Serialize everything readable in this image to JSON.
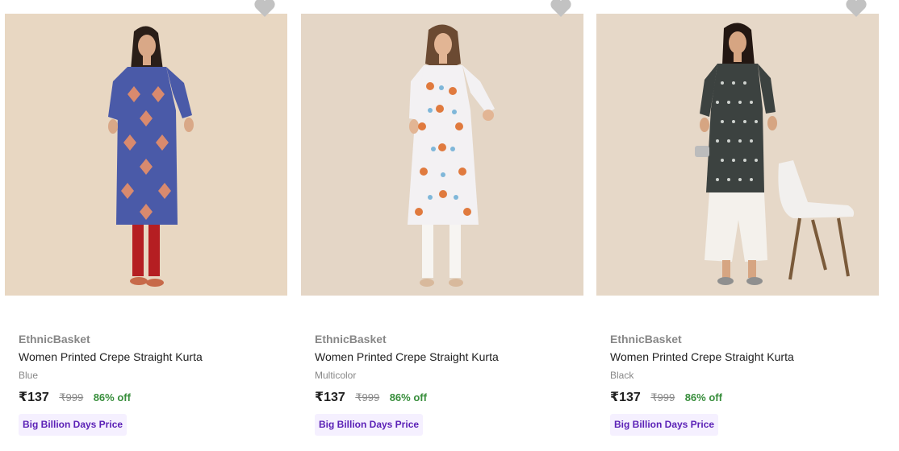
{
  "products": [
    {
      "brand": "EthnicBasket",
      "title": "Women Printed Crepe Straight Kurta",
      "color": "Blue",
      "price": "₹137",
      "mrp": "₹999",
      "discount": "86% off",
      "badge": "Big Billion Days Price",
      "wishlist_icon": "heart-icon",
      "image_colors": {
        "background": "#e8d7c2",
        "kurta": "#4a5aa8",
        "pattern": "#d98a6e",
        "bottom": "#b51e22"
      }
    },
    {
      "brand": "EthnicBasket",
      "title": "Women Printed Crepe Straight Kurta",
      "color": "Multicolor",
      "price": "₹137",
      "mrp": "₹999",
      "discount": "86% off",
      "badge": "Big Billion Days Price",
      "wishlist_icon": "heart-icon",
      "image_colors": {
        "background": "#e4d6c6",
        "kurta": "#f3f1f3",
        "pattern": "#e07a3e",
        "bottom": "#f7f5f2"
      }
    },
    {
      "brand": "EthnicBasket",
      "title": "Women Printed Crepe Straight Kurta",
      "color": "Black",
      "price": "₹137",
      "mrp": "₹999",
      "discount": "86% off",
      "badge": "Big Billion Days Price",
      "wishlist_icon": "heart-icon",
      "image_colors": {
        "background": "#e6d8c8",
        "kurta": "#3c4240",
        "pattern": "#cfd3cf",
        "bottom": "#f4f1ec"
      }
    }
  ],
  "colors": {
    "price_text": "#212121",
    "muted_text": "#878787",
    "discount_green": "#388e3c",
    "badge_bg": "#f5f0ff",
    "badge_text": "#5b21b6",
    "wishlist_heart": "#c2c2c2"
  }
}
